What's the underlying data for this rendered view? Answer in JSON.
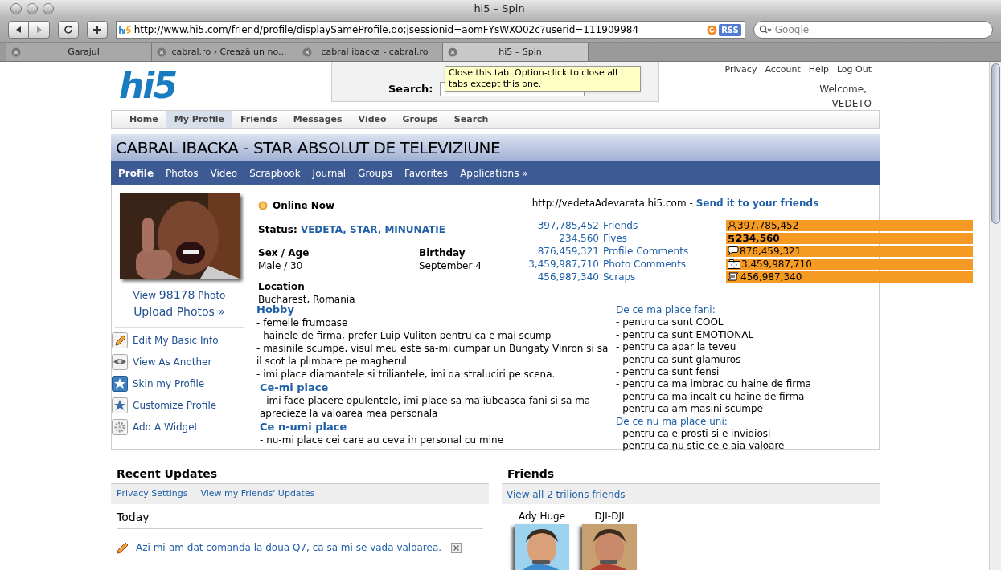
{
  "browser": {
    "title": "hi5 – Spin",
    "address": "http://www.hi5.com/friend/profile/displaySameProfile.do;jsessionid=aomFYsWXO02c?userid=111909984",
    "address_badge": "RSS",
    "search_placeholder": "Google",
    "tabs": [
      {
        "label": "Garajul",
        "selected": false
      },
      {
        "label": "cabral.ro › Crează un no...",
        "selected": false
      },
      {
        "label": "cabral ibacka - cabral.ro",
        "selected": false
      },
      {
        "label": "hi5 – Spin",
        "selected": true
      }
    ],
    "tooltip": "Close this tab. Option-click to close all tabs except this one."
  },
  "site": {
    "logo": "hi5",
    "search_label": "Search:",
    "top_links": [
      "Privacy",
      "Account",
      "Help",
      "Log Out"
    ],
    "welcome": "Welcome,",
    "username": "VEDETO",
    "nav": [
      {
        "label": "Home",
        "selected": false
      },
      {
        "label": "My Profile",
        "selected": true
      },
      {
        "label": "Friends",
        "selected": false
      },
      {
        "label": "Messages",
        "selected": false
      },
      {
        "label": "Video",
        "selected": false
      },
      {
        "label": "Groups",
        "selected": false
      },
      {
        "label": "Search",
        "selected": false
      }
    ]
  },
  "profile": {
    "title": "CABRAL IBACKA - STAR ABSOLUT DE TELEVIZIUNE",
    "subnav": [
      {
        "label": "Profile",
        "selected": true
      },
      {
        "label": "Photos",
        "selected": false
      },
      {
        "label": "Video",
        "selected": false
      },
      {
        "label": "Scrapbook",
        "selected": false
      },
      {
        "label": "Journal",
        "selected": false
      },
      {
        "label": "Groups",
        "selected": false
      },
      {
        "label": "Favorites",
        "selected": false
      },
      {
        "label": "Applications »",
        "selected": false
      }
    ],
    "view_photo": {
      "prefix": "View",
      "count": "98178",
      "suffix": "Photo"
    },
    "upload": "Upload Photos »",
    "actions": [
      {
        "kind": "pencil",
        "label": "Edit My Basic Info"
      },
      {
        "kind": "eye",
        "label": "View As Another"
      },
      {
        "kind": "skin",
        "label": "Skin my Profile"
      },
      {
        "kind": "star",
        "label": "Customize Profile"
      },
      {
        "kind": "gear",
        "label": "Add A Widget"
      }
    ],
    "online": "Online Now",
    "status_label": "Status:",
    "status": "VEDETA, STAR, MINUNATIE",
    "fields": [
      {
        "label": "Sex / Age",
        "value": "Male / 30"
      },
      {
        "label": "Birthday",
        "value": "September 4"
      },
      {
        "label": "Location",
        "value": "Bucharest, Romania"
      }
    ],
    "url": "http://vedetaAdevarata.hi5.com -",
    "send": "Send it to your friends",
    "stats": [
      {
        "count": "397,785,452",
        "label": "Friends"
      },
      {
        "count": "234,560",
        "label": "Fives"
      },
      {
        "count": "876,459,321",
        "label": "Profile Comments"
      },
      {
        "count": "3,459,987,710",
        "label": "Photo Comments"
      },
      {
        "count": "456,987,340",
        "label": "Scraps"
      }
    ],
    "bars": [
      {
        "kind": "person",
        "text": "397,785,452"
      },
      {
        "kind": "five",
        "prefix": "5",
        "text": "234,560"
      },
      {
        "kind": "comment",
        "text": "876,459,321"
      },
      {
        "kind": "camera",
        "text": "3,459,987,710"
      },
      {
        "kind": "scrap",
        "text": "456,987,340"
      }
    ],
    "sections_left": [
      {
        "heading": "Hobby",
        "lines": [
          "- femeile frumoase",
          "- hainele de firma, prefer Luip Vuliton pentru ca e mai scump",
          "- masinile scumpe, visul meu este sa-mi cumpar un Bungaty Vinron si sa il scot la plimbare pe magherul",
          "- imi place diamantele si triliantele, imi da straluciri pe scena."
        ]
      },
      {
        "heading": "Ce-mi place",
        "lines": [
          "- imi face placere opulentele, imi place sa ma iubeasca fani si sa ma aprecieze la valoarea mea personala"
        ]
      },
      {
        "heading": "Ce n-umi place",
        "lines": [
          "- nu-mi place cei care au ceva in personal cu mine"
        ]
      }
    ],
    "sections_right": [
      {
        "heading": "De ce ma place fani:",
        "lines": [
          "- pentru ca sunt COOL",
          "- pentru ca sunt EMOTIONAL",
          "- pentru ca apar la teveu",
          "- pentru ca sunt glamuros",
          "- pentru ca sunt fensi",
          "- pentru ca ma imbrac cu haine de firma",
          "- pentru ca ma incalt cu haine de firma",
          "- pentru ca am masini scumpe"
        ]
      },
      {
        "heading": "De ce nu ma place uni:",
        "lines": [
          "- pentru ca e prosti si e invidiosi",
          "- pentru ca nu stie ce e aia valoare"
        ]
      }
    ]
  },
  "updates": {
    "title": "Recent Updates",
    "links": [
      "Privacy Settings",
      "View my Friends' Updates"
    ],
    "day": "Today",
    "items": [
      {
        "text": "Azi mi-am dat comanda la doua Q7, ca sa mi se vada valoarea."
      }
    ]
  },
  "friends": {
    "title": "Friends",
    "link": "View all 2 trilions friends",
    "people": [
      {
        "name": "Ady Huge"
      },
      {
        "name": "DJI-DJI"
      }
    ]
  }
}
